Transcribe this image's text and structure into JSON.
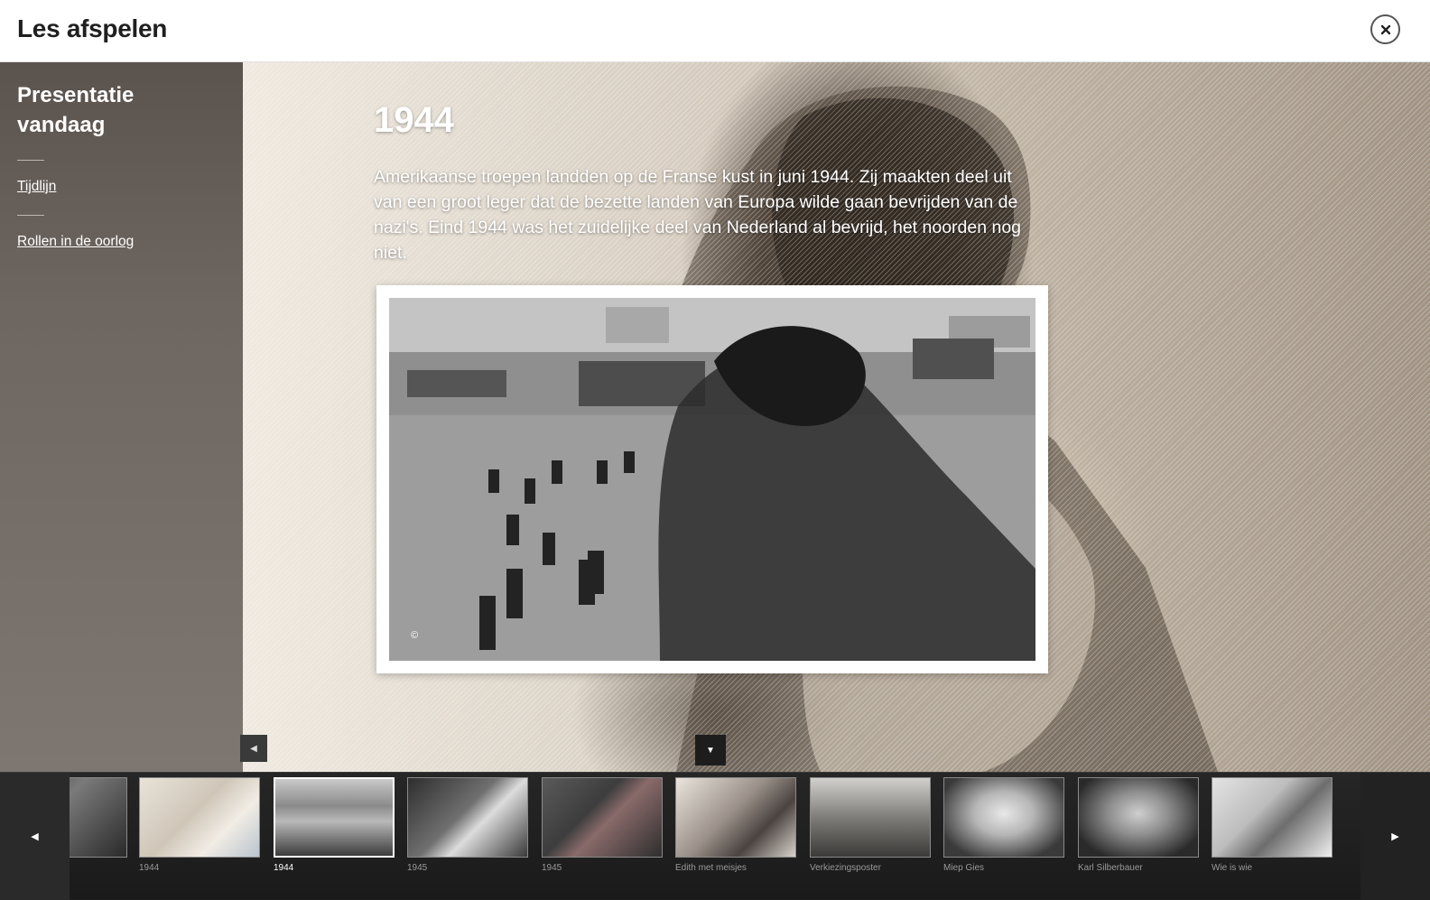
{
  "header": {
    "title": "Les afspelen",
    "close_icon": "close-icon"
  },
  "sidebar": {
    "title": "Presentatie vandaag",
    "links": [
      {
        "label": "Tijdlijn"
      },
      {
        "label": "Rollen in de oorlog"
      }
    ]
  },
  "slide": {
    "title": "1944",
    "body": "Amerikaanse troepen landden op de Franse kust in juni 1944. Zij maakten deel uit van een groot leger dat de bezette landen van Europa wilde gaan bevrijden van de nazi's. Eind 1944 was het zuidelijke deel van Nederland al bevrijd, het noorden nog niet.",
    "photo_copyright": "©"
  },
  "controls": {
    "side_toggle_icon": "triangle-left-icon",
    "collapse_icon": "triangle-down-icon",
    "prev_icon": "triangle-left-icon",
    "next_icon": "triangle-right-icon"
  },
  "filmstrip": {
    "items": [
      {
        "caption": "",
        "theme": "dark-portrait"
      },
      {
        "caption": "1944",
        "theme": "documents"
      },
      {
        "caption": "1944",
        "theme": "beach",
        "active": true
      },
      {
        "caption": "1945",
        "theme": "man-desk"
      },
      {
        "caption": "1945",
        "theme": "street-flags"
      },
      {
        "caption": "Edith met meisjes",
        "theme": "girls"
      },
      {
        "caption": "Verkiezingsposter",
        "theme": "crowd"
      },
      {
        "caption": "Miep Gies",
        "theme": "woman-portrait"
      },
      {
        "caption": "Karl Silberbauer",
        "theme": "man-portrait"
      },
      {
        "caption": "Wie is wie",
        "theme": "collage"
      }
    ]
  },
  "colors": {
    "sidebar_bg": "#6e6660",
    "filmstrip_bg": "#1e1e1e",
    "header_bg": "#ffffff"
  }
}
